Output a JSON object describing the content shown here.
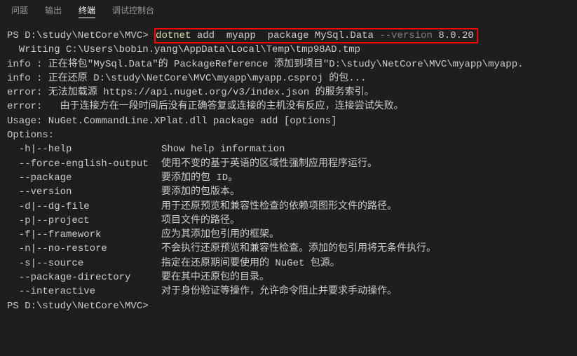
{
  "tabs": {
    "problems": "问题",
    "output": "输出",
    "terminal": "终端",
    "debug_console": "调试控制台"
  },
  "terminal": {
    "empty": "",
    "prompt1": "PS D:\\study\\NetCore\\MVC> ",
    "cmd_dotnet": "dotnet",
    "cmd_add": " add  myapp  package ",
    "cmd_pkg": "MySql.Data",
    "cmd_version_flag": " --version",
    "cmd_version_val": " 8.0.20",
    "line_writing": "  Writing C:\\Users\\bobin.yang\\AppData\\Local\\Temp\\tmp98AD.tmp",
    "line_info1": "info : 正在将包\"MySql.Data\"的 PackageReference 添加到项目\"D:\\study\\NetCore\\MVC\\myapp\\myapp.",
    "line_info2": "info : 正在还原 D:\\study\\NetCore\\MVC\\myapp\\myapp.csproj 的包...",
    "line_error1": "error: 无法加载源 https://api.nuget.org/v3/index.json 的服务索引。",
    "line_error2": "error:   由于连接方在一段时间后没有正确答复或连接的主机没有反应，连接尝试失败。",
    "blank_after_errors": "",
    "blank2": "",
    "usage_line": "Usage: NuGet.CommandLine.XPlat.dll package add [options]",
    "blank3": "",
    "options_header": "Options:",
    "opt_help_flag": "  -h|--help",
    "opt_help_desc": "Show help information",
    "opt_force_flag": "  --force-english-output",
    "opt_force_desc": "使用不变的基于英语的区域性强制应用程序运行。",
    "opt_package_flag": "  --package",
    "opt_package_desc": "要添加的包 ID。",
    "opt_version_flag": "  --version",
    "opt_version_desc": "要添加的包版本。",
    "opt_dg_flag": "  -d|--dg-file",
    "opt_dg_desc": "用于还原预览和兼容性检查的依赖项图形文件的路径。",
    "opt_project_flag": "  -p|--project",
    "opt_project_desc": "项目文件的路径。",
    "opt_framework_flag": "  -f|--framework",
    "opt_framework_desc": "应为其添加包引用的框架。",
    "opt_norestore_flag": "  -n|--no-restore",
    "opt_norestore_desc": "不会执行还原预览和兼容性检查。添加的包引用将无条件执行。",
    "opt_source_flag": "  -s|--source",
    "opt_source_desc": "指定在还原期间要使用的 NuGet 包源。",
    "opt_pkgdir_flag": "  --package-directory",
    "opt_pkgdir_desc": "要在其中还原包的目录。",
    "opt_interactive_flag": "  --interactive",
    "opt_interactive_desc": "对于身份验证等操作，允许命令阻止并要求手动操作。",
    "prompt2": "PS D:\\study\\NetCore\\MVC> "
  }
}
